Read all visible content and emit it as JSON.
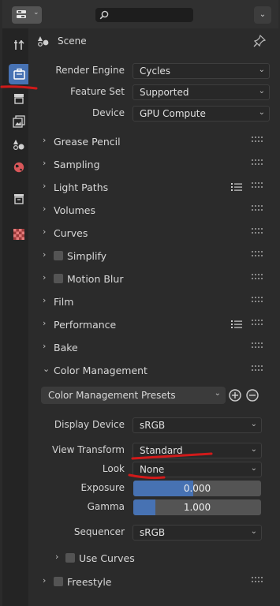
{
  "header": {
    "search_placeholder": ""
  },
  "scene_header": {
    "label": "Scene"
  },
  "render": {
    "engine_label": "Render Engine",
    "engine_value": "Cycles",
    "feature_label": "Feature Set",
    "feature_value": "Supported",
    "device_label": "Device",
    "device_value": "GPU Compute"
  },
  "sections": {
    "grease_pencil": "Grease Pencil",
    "sampling": "Sampling",
    "light_paths": "Light Paths",
    "volumes": "Volumes",
    "curves": "Curves",
    "simplify": "Simplify",
    "motion_blur": "Motion Blur",
    "film": "Film",
    "performance": "Performance",
    "bake": "Bake",
    "color_management": "Color Management",
    "use_curves": "Use Curves",
    "freestyle": "Freestyle"
  },
  "color_management": {
    "presets_label": "Color Management Presets",
    "display_device_label": "Display Device",
    "display_device_value": "sRGB",
    "view_transform_label": "View Transform",
    "view_transform_value": "Standard",
    "look_label": "Look",
    "look_value": "None",
    "exposure_label": "Exposure",
    "exposure_value": "0.000",
    "exposure_fill": 0.47,
    "gamma_label": "Gamma",
    "gamma_value": "1.000",
    "gamma_fill": 0.17,
    "sequencer_label": "Sequencer",
    "sequencer_value": "sRGB"
  },
  "colors": {
    "accent": "#4772b3",
    "annotation": "#d01a1a"
  }
}
